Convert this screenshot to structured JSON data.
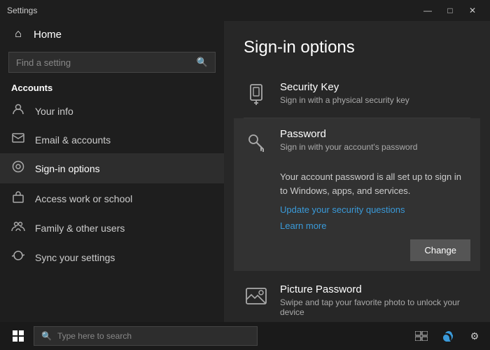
{
  "titlebar": {
    "title": "Settings",
    "minimize": "—",
    "maximize": "□",
    "close": "✕"
  },
  "sidebar": {
    "home_label": "Home",
    "search_placeholder": "Find a setting",
    "section_header": "Accounts",
    "items": [
      {
        "id": "your-info",
        "label": "Your info",
        "icon": "👤"
      },
      {
        "id": "email-accounts",
        "label": "Email & accounts",
        "icon": "✉"
      },
      {
        "id": "sign-in-options",
        "label": "Sign-in options",
        "icon": "🔑"
      },
      {
        "id": "access-work",
        "label": "Access work or school",
        "icon": "👔"
      },
      {
        "id": "family-users",
        "label": "Family & other users",
        "icon": "👥"
      },
      {
        "id": "sync-settings",
        "label": "Sync your settings",
        "icon": "🔄"
      }
    ]
  },
  "main": {
    "page_title": "Sign-in options",
    "options": [
      {
        "id": "security-key",
        "title": "Security Key",
        "desc": "Sign in with a physical security key",
        "icon": "🔲",
        "expanded": false
      },
      {
        "id": "password",
        "title": "Password",
        "desc": "Sign in with your account's password",
        "icon": "🔑",
        "expanded": true,
        "body_text": "Your account password is all set up to sign in to Windows, apps, and services.",
        "link1": "Update your security questions",
        "link2": "Learn more",
        "button_label": "Change"
      },
      {
        "id": "picture-password",
        "title": "Picture Password",
        "desc": "Swipe and tap your favorite photo to unlock your device",
        "icon": "🖼",
        "expanded": false
      }
    ]
  },
  "taskbar": {
    "search_placeholder": "Type here to search",
    "icons": [
      "⊞",
      "🔍",
      "🌐",
      "⚙"
    ]
  }
}
